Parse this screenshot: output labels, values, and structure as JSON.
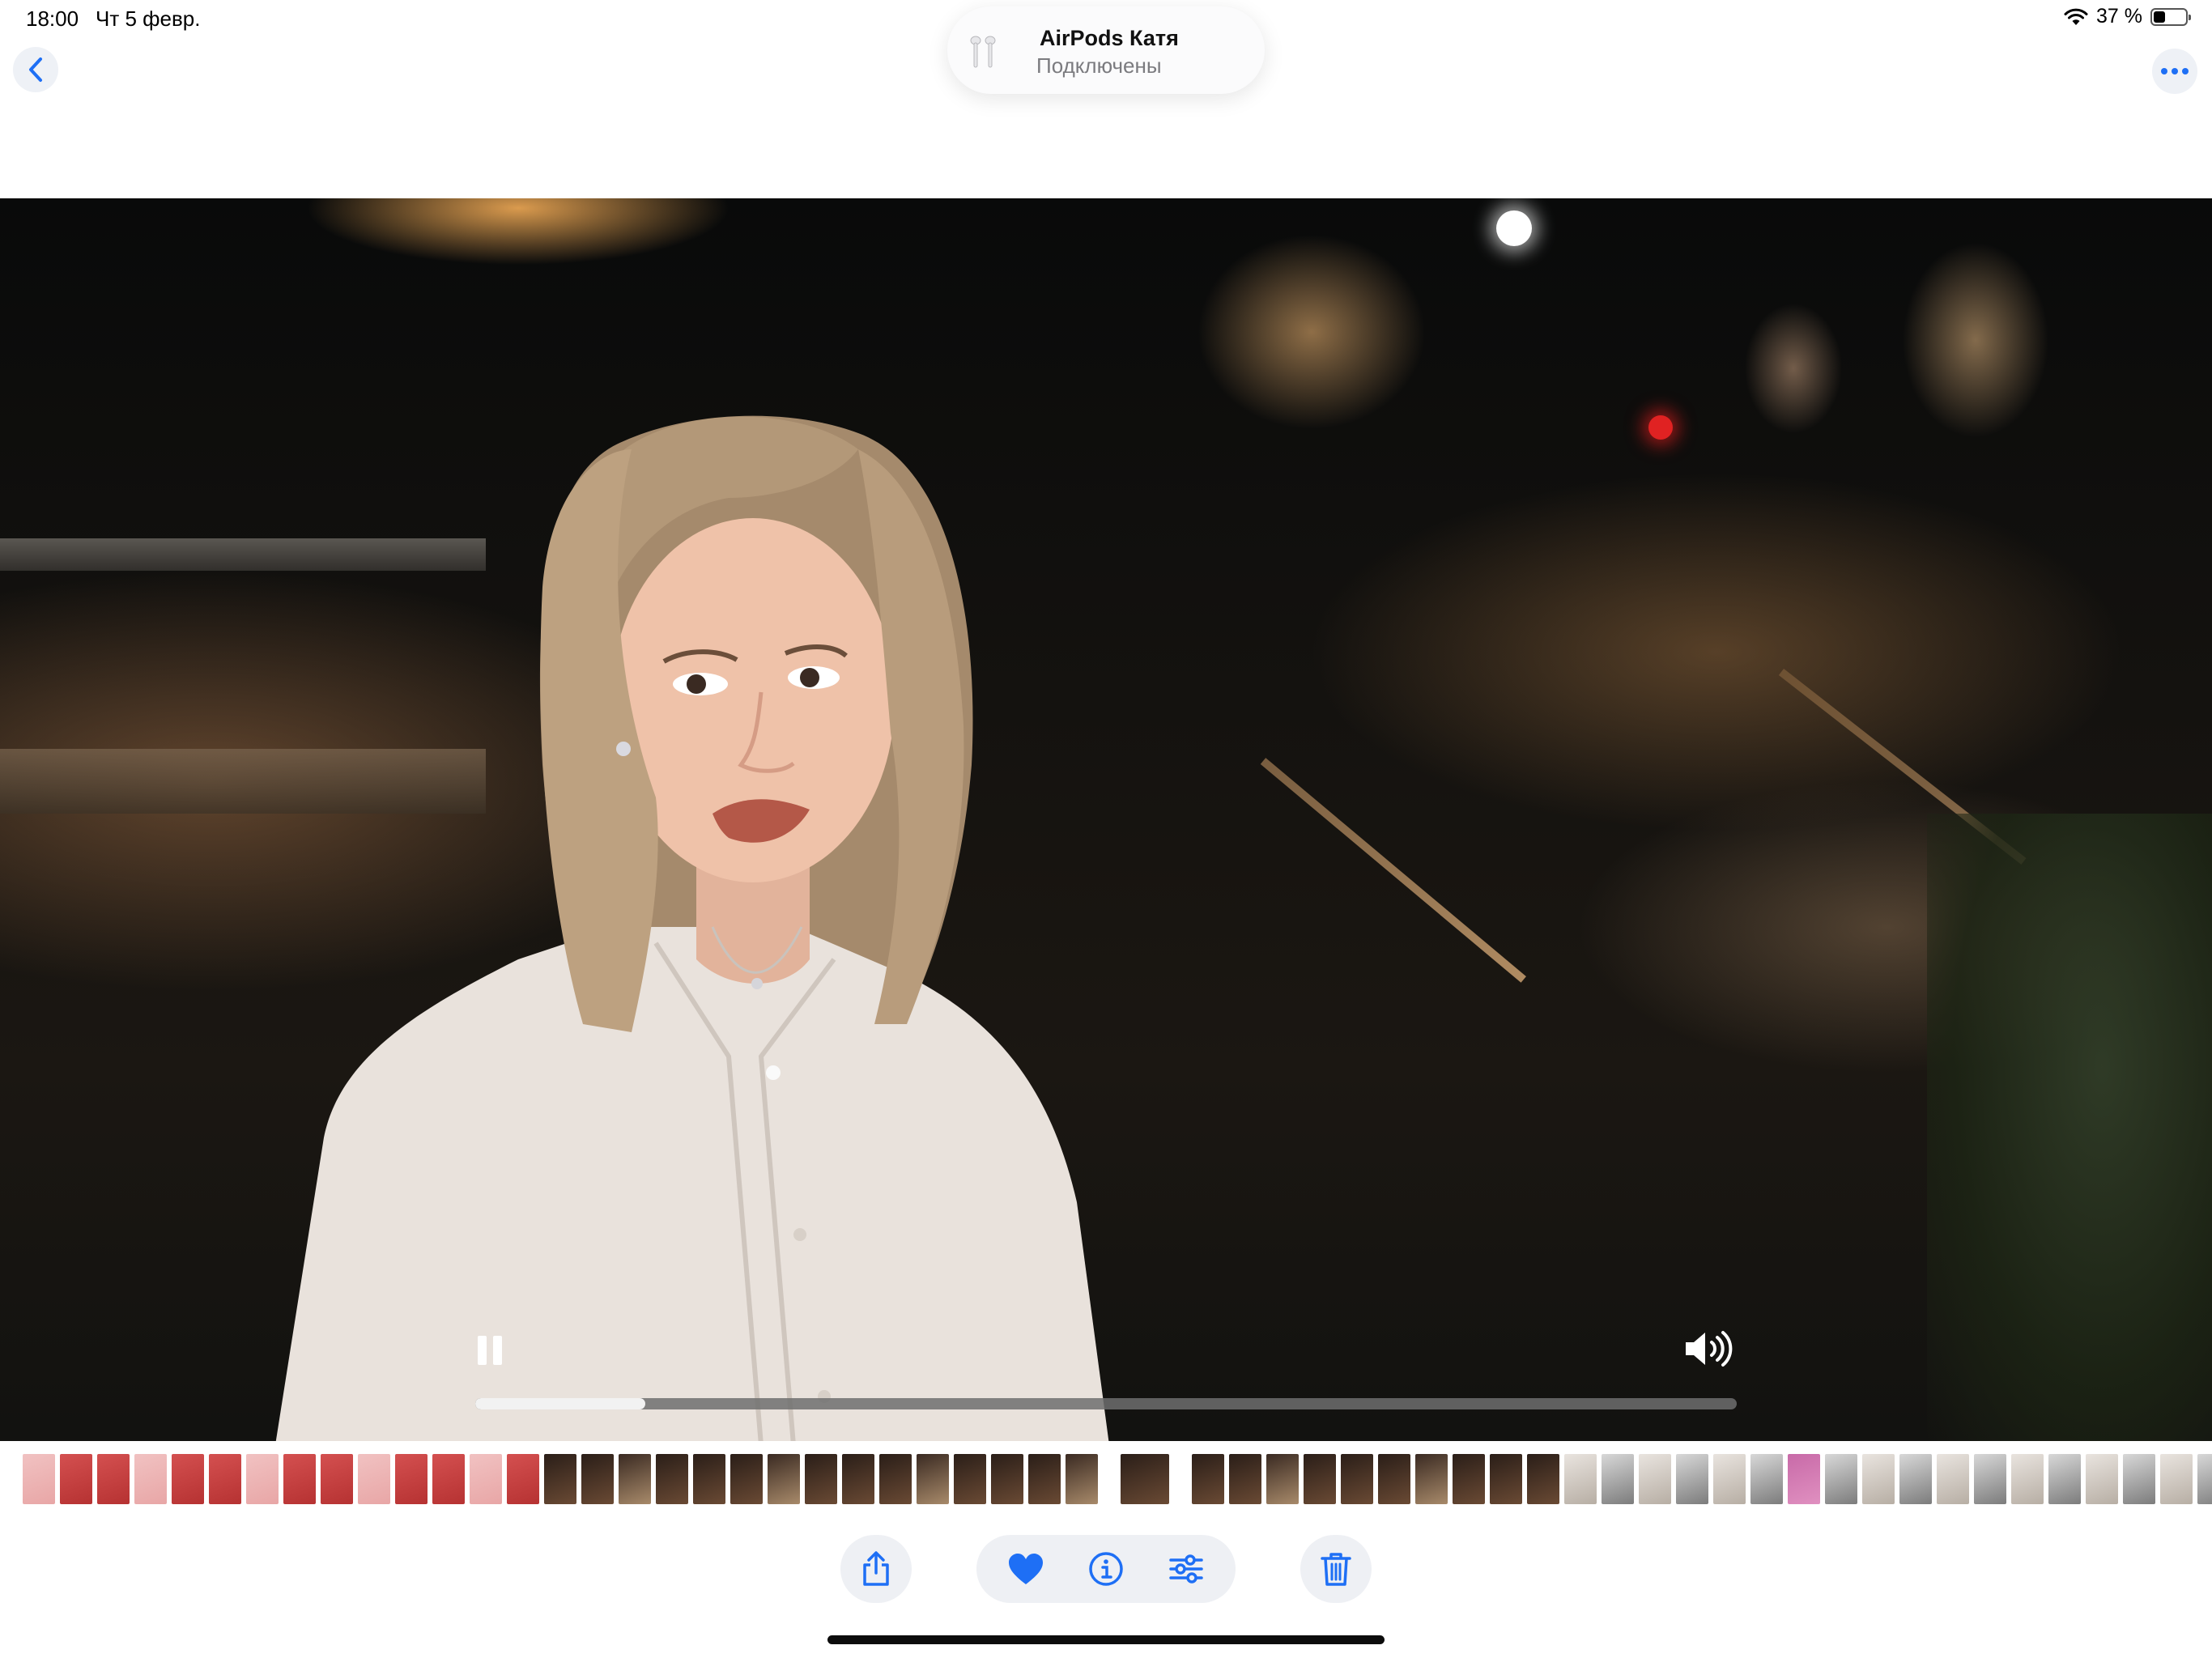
{
  "status_bar": {
    "time": "18:00",
    "date": "Чт 5 февр.",
    "battery_percent_text": "37 %",
    "battery_level": 0.37
  },
  "airpods_banner": {
    "title": "AirPods Катя",
    "subtitle": "Подключены"
  },
  "nav": {
    "back_icon": "chevron-left-icon",
    "more_icon": "ellipsis-icon"
  },
  "player": {
    "progress": 0.135,
    "state": "playing",
    "volume_icon": "speaker-wave-icon"
  },
  "thumbnails": {
    "count": 58,
    "selected_index": 29
  },
  "toolbar": {
    "share_icon": "share-icon",
    "favorite_icon": "heart-icon",
    "info_icon": "info-icon",
    "adjust_icon": "sliders-icon",
    "delete_icon": "trash-icon"
  },
  "colors": {
    "accent": "#1e6ff5",
    "pill_bg": "#eef0f4"
  }
}
